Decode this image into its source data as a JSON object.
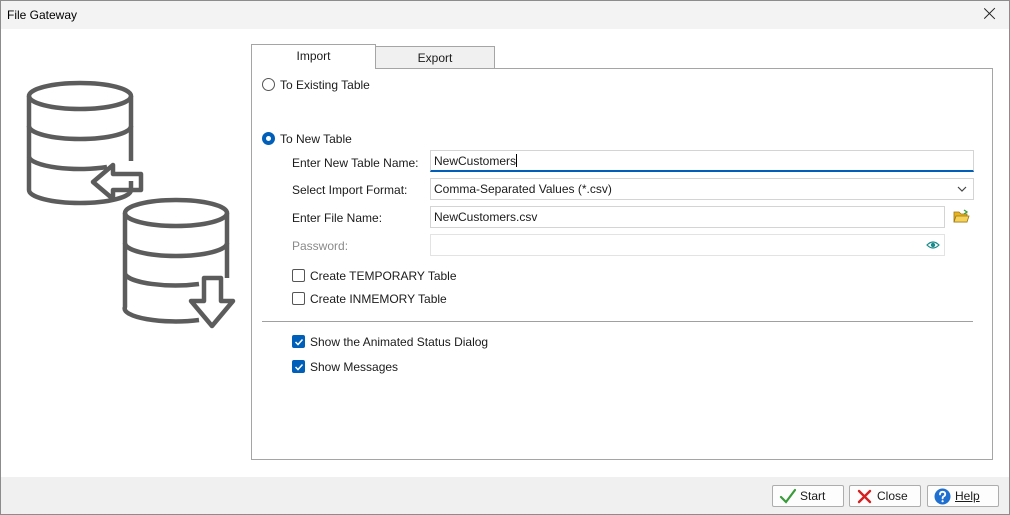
{
  "window": {
    "title": "File Gateway"
  },
  "tabs": [
    {
      "label": "Import",
      "active": true
    },
    {
      "label": "Export",
      "active": false
    }
  ],
  "import": {
    "radio_existing": {
      "label": "To Existing Table",
      "checked": false
    },
    "radio_new": {
      "label": "To New Table",
      "checked": true
    },
    "table_name": {
      "label": "Enter New Table Name:",
      "value": "NewCustomers"
    },
    "import_format": {
      "label": "Select Import Format:",
      "value": "Comma-Separated Values  (*.csv)"
    },
    "file_name": {
      "label": "Enter File Name:",
      "value": "NewCustomers.csv"
    },
    "password": {
      "label": "Password:",
      "value": ""
    },
    "temporary": {
      "label": "Create TEMPORARY Table",
      "checked": false
    },
    "inmemory": {
      "label": "Create INMEMORY Table",
      "checked": false
    },
    "animated_status": {
      "label": "Show the Animated Status Dialog",
      "checked": true
    },
    "show_messages": {
      "label": "Show Messages",
      "checked": true
    }
  },
  "buttons": {
    "start": "Start",
    "close": "Close",
    "help": "Help"
  },
  "icons": {
    "titlebar_close": "close-icon",
    "graphic": "database-import-icon",
    "browse": "open-folder-icon",
    "reveal_password": "eye-icon",
    "dropdown": "chevron-down-icon",
    "start": "checkmark-icon",
    "close": "red-x-icon",
    "help": "question-mark-icon"
  },
  "colors": {
    "accent": "#005fb8",
    "graphic": "#5c5c5c",
    "start_check": "#3a9b3a",
    "close_x": "#d42020",
    "help_circle": "#1f6fd0"
  }
}
